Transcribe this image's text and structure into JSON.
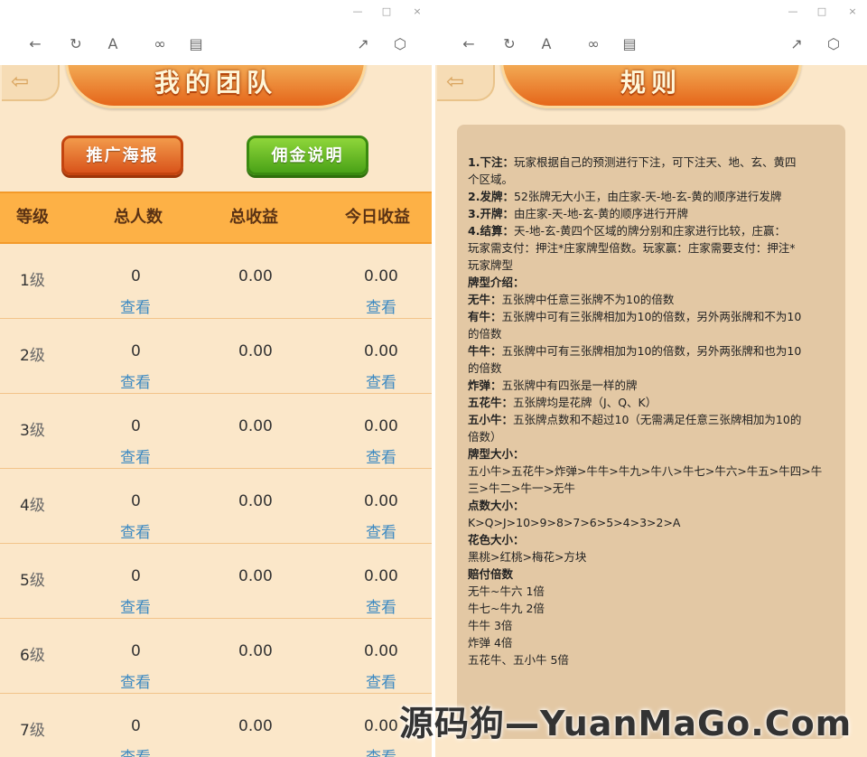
{
  "window_controls": {
    "minimize": "—",
    "maximize": "□",
    "close": "×"
  },
  "toolbar_icons": [
    "back-arrow-icon",
    "refresh-icon",
    "font-size-icon",
    "link-icon",
    "window-icon",
    "share-icon",
    "cube-icon"
  ],
  "left": {
    "title": "我的团队",
    "buttons": {
      "poster": "推广海报",
      "commission": "佣金说明"
    },
    "table": {
      "headers": [
        "等级",
        "总人数",
        "总收益",
        "今日收益"
      ],
      "view_label": "查看",
      "level_suffix": "级",
      "rows": [
        {
          "level": "1",
          "count": "0",
          "total": "0.00",
          "today": "0.00"
        },
        {
          "level": "2",
          "count": "0",
          "total": "0.00",
          "today": "0.00"
        },
        {
          "level": "3",
          "count": "0",
          "total": "0.00",
          "today": "0.00"
        },
        {
          "level": "4",
          "count": "0",
          "total": "0.00",
          "today": "0.00"
        },
        {
          "level": "5",
          "count": "0",
          "total": "0.00",
          "today": "0.00"
        },
        {
          "level": "6",
          "count": "0",
          "total": "0.00",
          "today": "0.00"
        },
        {
          "level": "7",
          "count": "0",
          "total": "0.00",
          "today": "0.00"
        }
      ]
    }
  },
  "right": {
    "title": "规则",
    "rules": [
      {
        "bold": "1.下注：",
        "text": "玩家根据自己的预测进行下注，可下注天、地、玄、黄四"
      },
      {
        "bold": "",
        "text": "个区域。"
      },
      {
        "bold": "2.发牌：",
        "text": "52张牌无大小王，由庄家-天-地-玄-黄的顺序进行发牌"
      },
      {
        "bold": "3.开牌：",
        "text": "由庄家-天-地-玄-黄的顺序进行开牌"
      },
      {
        "bold": "4.结算：",
        "text": "天-地-玄-黄四个区域的牌分别和庄家进行比较，庄赢："
      },
      {
        "bold": "",
        "text": "玩家需支付：押注*庄家牌型倍数。玩家赢：庄家需要支付：押注*"
      },
      {
        "bold": "",
        "text": "玩家牌型"
      },
      {
        "bold": "牌型介绍：",
        "text": ""
      },
      {
        "bold": "无牛：",
        "text": "五张牌中任意三张牌不为10的倍数"
      },
      {
        "bold": "有牛：",
        "text": "五张牌中可有三张牌相加为10的倍数，另外两张牌和不为10"
      },
      {
        "bold": "",
        "text": "的倍数"
      },
      {
        "bold": "牛牛：",
        "text": "五张牌中可有三张牌相加为10的倍数，另外两张牌和也为10"
      },
      {
        "bold": "",
        "text": "的倍数"
      },
      {
        "bold": "炸弹：",
        "text": "五张牌中有四张是一样的牌"
      },
      {
        "bold": "五花牛：",
        "text": "五张牌均是花牌（J、Q、K）"
      },
      {
        "bold": "五小牛：",
        "text": "五张牌点数和不超过10（无需满足任意三张牌相加为10的"
      },
      {
        "bold": "",
        "text": "倍数）"
      },
      {
        "bold": "牌型大小：",
        "text": ""
      },
      {
        "bold": "",
        "text": "五小牛>五花牛>炸弹>牛牛>牛九>牛八>牛七>牛六>牛五>牛四>牛"
      },
      {
        "bold": "",
        "text": "三>牛二>牛一>无牛"
      },
      {
        "bold": "点数大小：",
        "text": ""
      },
      {
        "bold": "",
        "text": "K>Q>J>10>9>8>7>6>5>4>3>2>A"
      },
      {
        "bold": "花色大小：",
        "text": ""
      },
      {
        "bold": "",
        "text": "黑桃>红桃>梅花>方块"
      },
      {
        "bold": "赔付倍数",
        "text": ""
      },
      {
        "bold": "",
        "text": "无牛~牛六  1倍"
      },
      {
        "bold": "",
        "text": "牛七~牛九  2倍"
      },
      {
        "bold": "",
        "text": "牛牛  3倍"
      },
      {
        "bold": "",
        "text": "炸弹  4倍"
      },
      {
        "bold": "",
        "text": "五花牛、五小牛 5倍"
      }
    ]
  },
  "watermark": "源码狗—YuanMaGo.Com"
}
